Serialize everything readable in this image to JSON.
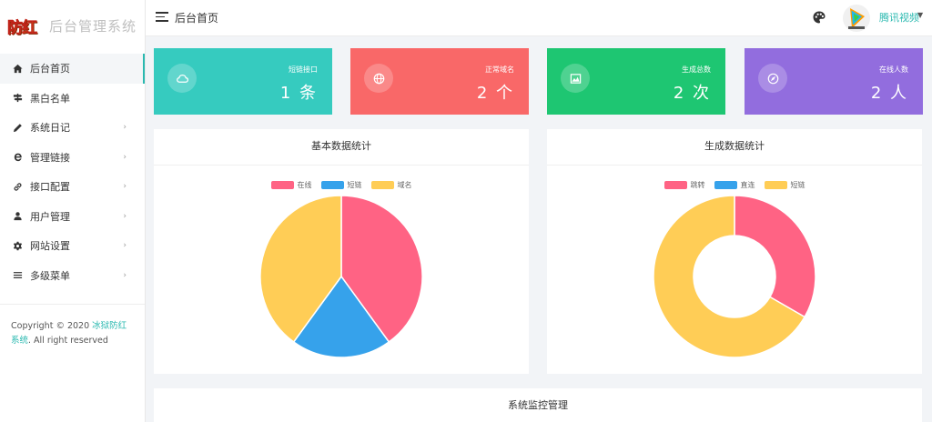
{
  "brand": {
    "logo_text": "防红",
    "title": "后台管理系统"
  },
  "header": {
    "page_title": "后台首页",
    "user_name": "腾讯视频"
  },
  "sidebar": {
    "items": [
      {
        "label": "后台首页",
        "icon": "home-icon",
        "arrow": ""
      },
      {
        "label": "黑白名单",
        "icon": "signpost-icon",
        "arrow": ""
      },
      {
        "label": "系统日记",
        "icon": "pencil-icon",
        "arrow": "›"
      },
      {
        "label": "管理链接",
        "icon": "ie-browser-icon",
        "arrow": "›"
      },
      {
        "label": "接口配置",
        "icon": "link-icon",
        "arrow": "›"
      },
      {
        "label": "用户管理",
        "icon": "user-icon",
        "arrow": "›"
      },
      {
        "label": "网站设置",
        "icon": "gear-icon",
        "arrow": "›"
      },
      {
        "label": "多级菜单",
        "icon": "menu-lines-icon",
        "arrow": "›"
      }
    ],
    "copyright_prefix": "Copyright © 2020 ",
    "copyright_link": "冰狱防红系统",
    "copyright_suffix": ". All right reserved"
  },
  "cards": [
    {
      "label": "短链接口",
      "value": "1 条",
      "color": "#36cbbf",
      "icon": "cloud-icon"
    },
    {
      "label": "正常域名",
      "value": "2 个",
      "color": "#f96868",
      "icon": "globe-icon"
    },
    {
      "label": "生成总数",
      "value": "2 次",
      "color": "#1ec672",
      "icon": "chart-image-icon"
    },
    {
      "label": "在线人数",
      "value": "2 人",
      "color": "#926dde",
      "icon": "compass-icon"
    }
  ],
  "panels": {
    "basic": {
      "title": "基本数据统计"
    },
    "generate": {
      "title": "生成数据统计"
    },
    "monitor": {
      "title": "系统监控管理"
    }
  },
  "chart_data": [
    {
      "type": "pie",
      "title": "基本数据统计",
      "categories": [
        "在线",
        "短链",
        "域名"
      ],
      "values": [
        2,
        1,
        2
      ],
      "colors": [
        "#ff6384",
        "#36a2eb",
        "#ffcd56"
      ],
      "legend": "top"
    },
    {
      "type": "pie",
      "variant": "doughnut",
      "title": "生成数据统计",
      "categories": [
        "跳转",
        "直连",
        "短链"
      ],
      "values": [
        1,
        0,
        2
      ],
      "colors": [
        "#ff6384",
        "#36a2eb",
        "#ffcd56"
      ],
      "legend": "top"
    }
  ]
}
